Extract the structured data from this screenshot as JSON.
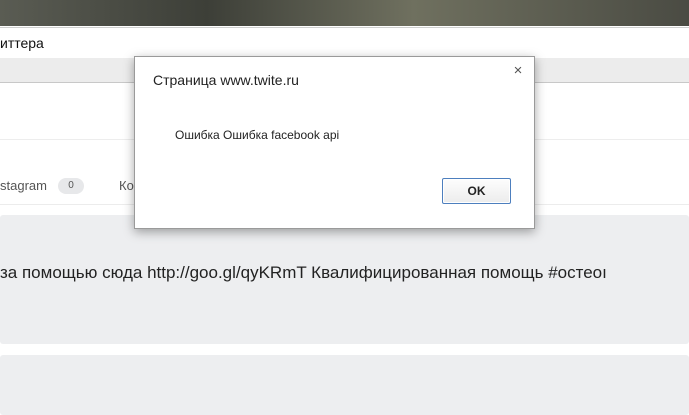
{
  "page": {
    "title": "иттера",
    "tabs": [
      {
        "label": "stagram",
        "count": "0"
      },
      {
        "label": "Ко"
      }
    ],
    "post": {
      "text": "за помощью сюда http://goo.gl/qyKRmT Квалифицированная помощь #остеоı"
    }
  },
  "dialog": {
    "title": "Страница www.twite.ru",
    "close_icon": "×",
    "message": "Ошибка Ошибка facebook api",
    "ok_label": "OK"
  }
}
